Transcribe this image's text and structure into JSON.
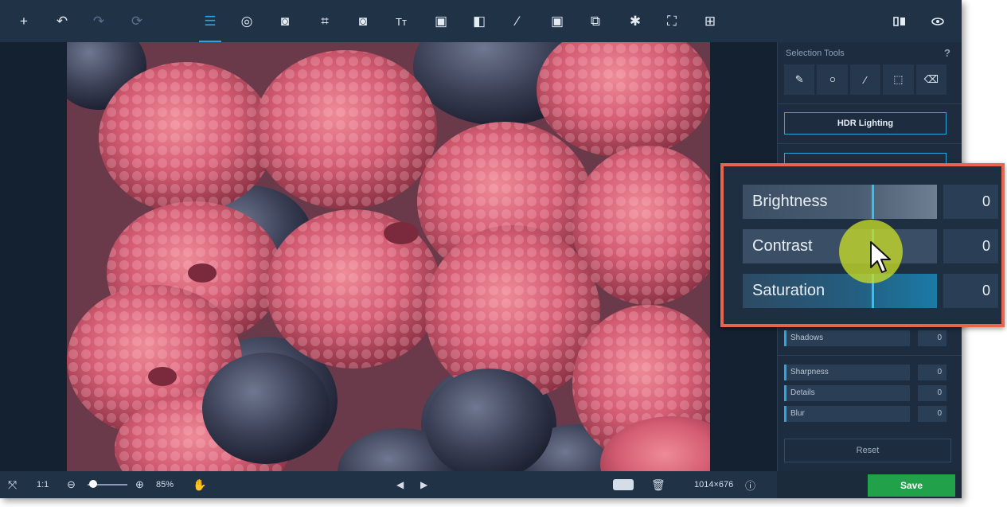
{
  "toolbar": {
    "tools": [
      {
        "name": "add-icon",
        "glyph": "+"
      },
      {
        "name": "undo-icon",
        "glyph": "↶"
      },
      {
        "name": "redo-icon",
        "glyph": "↷"
      },
      {
        "name": "revert-icon",
        "glyph": "⟳"
      },
      {
        "name": "adjust-icon",
        "glyph": "☰"
      },
      {
        "name": "filters-icon",
        "glyph": "◎"
      },
      {
        "name": "enhance-icon",
        "glyph": "◙"
      },
      {
        "name": "crop-icon",
        "glyph": "⌗"
      },
      {
        "name": "rotate-icon",
        "glyph": "◙"
      },
      {
        "name": "text-icon",
        "glyph": "Tт"
      },
      {
        "name": "frame-icon",
        "glyph": "▣"
      },
      {
        "name": "vignette-icon",
        "glyph": "◧"
      },
      {
        "name": "magic-wand-icon",
        "glyph": "⁄"
      },
      {
        "name": "image-icon",
        "glyph": "▣"
      },
      {
        "name": "clone-icon",
        "glyph": "⧉"
      },
      {
        "name": "pin-icon",
        "glyph": "✱"
      },
      {
        "name": "fullscreen-icon",
        "glyph": "⛶"
      },
      {
        "name": "layout-icon",
        "glyph": "⊞"
      }
    ],
    "compare_icon": "compare-icon",
    "preview_icon": "eye-icon"
  },
  "panel": {
    "title": "Selection Tools",
    "help": "?",
    "selection_tools": [
      "brush-icon",
      "lasso-icon",
      "magic-wand-icon",
      "rect-select-icon",
      "eraser-icon"
    ],
    "hdr_button": "HDR Lighting",
    "shadows_label": "Shadows",
    "shadows_value": "0",
    "sharpness_rows": [
      {
        "label": "Sharpness",
        "value": "0"
      },
      {
        "label": "Details",
        "value": "0"
      },
      {
        "label": "Blur",
        "value": "0"
      }
    ],
    "reset_label": "Reset"
  },
  "callout": {
    "rows": [
      {
        "label": "Brightness",
        "value": "0"
      },
      {
        "label": "Contrast",
        "value": "0"
      },
      {
        "label": "Saturation",
        "value": "0"
      }
    ]
  },
  "bottombar": {
    "ratio": "1:1",
    "zoom": "85%",
    "dimensions": "1014×676"
  },
  "save_label": "Save",
  "colors": {
    "accent": "#2ca5e0",
    "callout_border": "#e9644c",
    "save": "#21a14a"
  }
}
